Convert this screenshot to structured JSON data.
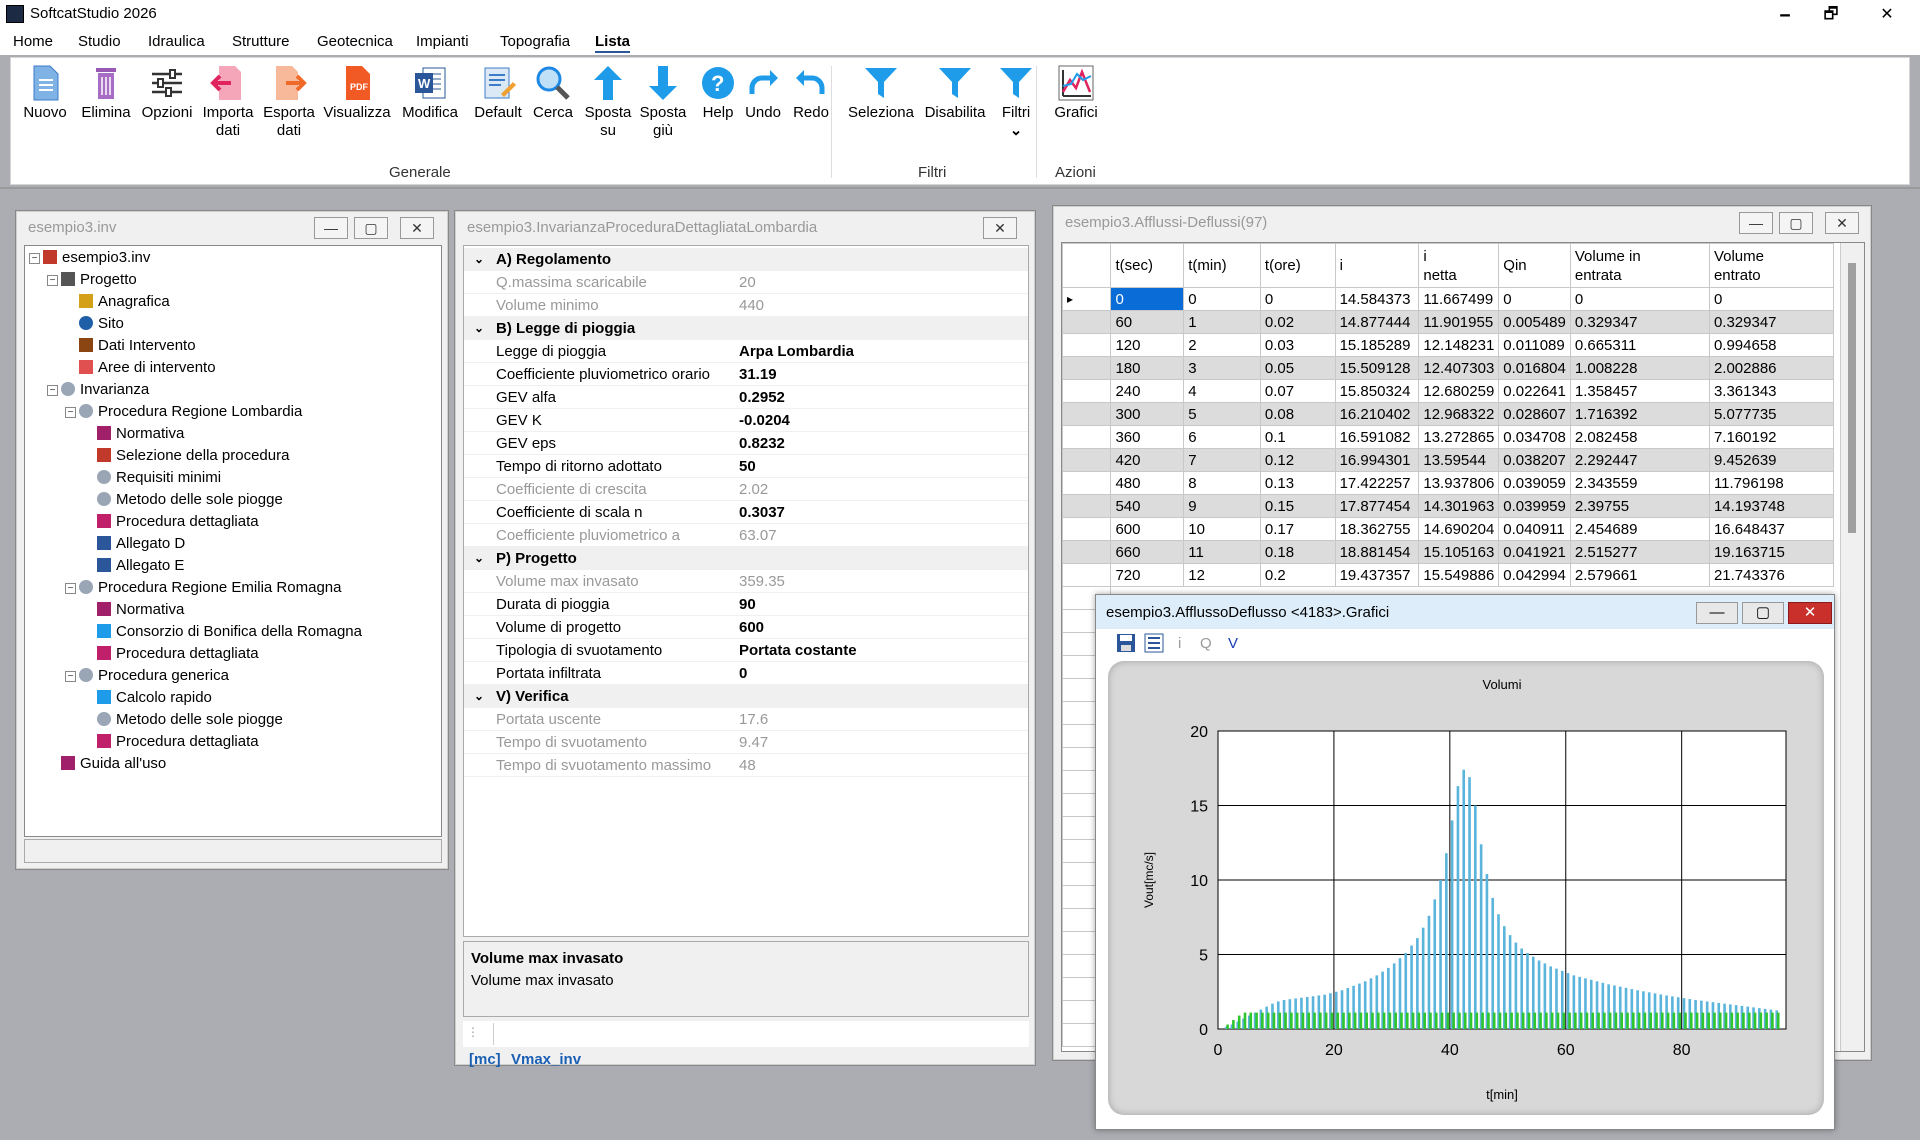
{
  "app": {
    "title": "SoftcatStudio 2026",
    "min": "🗕",
    "max": "🗗",
    "close": "✕"
  },
  "menu": [
    "Home",
    "Studio",
    "Idraulica",
    "Strutture",
    "Geotecnica",
    "Impianti",
    "Topografia",
    "Lista"
  ],
  "ribbon": {
    "buttons": [
      {
        "label": "Nuovo",
        "icon": "new-doc-icon"
      },
      {
        "label": "Elimina",
        "icon": "trash-icon"
      },
      {
        "label": "Opzioni",
        "icon": "sliders-icon"
      },
      {
        "label": "Importa dati",
        "icon": "import-icon"
      },
      {
        "label": "Esporta dati",
        "icon": "export-icon"
      },
      {
        "label": "Visualizza",
        "icon": "pdf-icon"
      },
      {
        "label": "Modifica",
        "icon": "word-icon"
      },
      {
        "label": "Default",
        "icon": "default-icon"
      },
      {
        "label": "Cerca",
        "icon": "search-icon"
      },
      {
        "label": "Sposta su",
        "icon": "arrow-up-icon"
      },
      {
        "label": "Sposta giù",
        "icon": "arrow-down-icon"
      },
      {
        "label": "Help",
        "icon": "help-icon"
      },
      {
        "label": "Undo",
        "icon": "undo-icon"
      },
      {
        "label": "Redo",
        "icon": "redo-icon"
      },
      {
        "label": "Seleziona",
        "icon": "filter-icon"
      },
      {
        "label": "Disabilita",
        "icon": "filter-icon"
      },
      {
        "label": "Filtri",
        "icon": "filter-icon"
      },
      {
        "label": "Grafici",
        "icon": "chart-icon"
      }
    ],
    "groups": {
      "generale": "Generale",
      "filtri": "Filtri",
      "azioni": "Azioni"
    },
    "filtri_chevron": "⌄"
  },
  "tree_window": {
    "title": "esempio3.inv"
  },
  "tree": [
    {
      "label": "esempio3.inv",
      "level": 0,
      "exp": "−"
    },
    {
      "label": "Progetto",
      "level": 1,
      "exp": "−"
    },
    {
      "label": "Anagrafica",
      "level": 2
    },
    {
      "label": "Sito",
      "level": 2
    },
    {
      "label": "Dati Intervento",
      "level": 2
    },
    {
      "label": "Aree di intervento",
      "level": 2
    },
    {
      "label": "Invarianza",
      "level": 1,
      "exp": "−"
    },
    {
      "label": "Procedura Regione Lombardia",
      "level": 2,
      "exp": "−"
    },
    {
      "label": "Normativa",
      "level": 3
    },
    {
      "label": "Selezione della procedura",
      "level": 3
    },
    {
      "label": "Requisiti minimi",
      "level": 3
    },
    {
      "label": "Metodo delle sole piogge",
      "level": 3
    },
    {
      "label": "Procedura dettagliata",
      "level": 3
    },
    {
      "label": "Allegato D",
      "level": 3
    },
    {
      "label": "Allegato E",
      "level": 3
    },
    {
      "label": "Procedura Regione Emilia Romagna",
      "level": 2,
      "exp": "−"
    },
    {
      "label": "Normativa",
      "level": 3
    },
    {
      "label": "Consorzio di Bonifica della Romagna",
      "level": 3
    },
    {
      "label": "Procedura dettagliata",
      "level": 3
    },
    {
      "label": "Procedura generica",
      "level": 2,
      "exp": "−"
    },
    {
      "label": "Calcolo rapido",
      "level": 3
    },
    {
      "label": "Metodo delle sole piogge",
      "level": 3
    },
    {
      "label": "Procedura dettagliata",
      "level": 3
    },
    {
      "label": "Guida all'uso",
      "level": 1
    }
  ],
  "prop_window": {
    "title": "esempio3.InvarianzaProceduraDettagliataLombardia"
  },
  "props": [
    {
      "cat": true,
      "name": "A) Regolamento"
    },
    {
      "name": "Q.massima scaricabile",
      "value": "20",
      "ro": true
    },
    {
      "name": "Volume minimo",
      "value": "440",
      "ro": true
    },
    {
      "cat": true,
      "name": "B) Legge di pioggia"
    },
    {
      "name": "Legge di pioggia",
      "value": "Arpa Lombardia",
      "b": true
    },
    {
      "name": "Coefficiente pluviometrico orario",
      "value": "31.19",
      "b": true
    },
    {
      "name": "GEV alfa",
      "value": "0.2952",
      "b": true
    },
    {
      "name": "GEV K",
      "value": "-0.0204",
      "b": true
    },
    {
      "name": "GEV eps",
      "value": "0.8232",
      "b": true
    },
    {
      "name": "Tempo di ritorno adottato",
      "value": "50",
      "b": true
    },
    {
      "name": "Coefficiente di crescita",
      "value": "2.02",
      "ro": true
    },
    {
      "name": "Coefficiente di scala n",
      "value": "0.3037",
      "b": true
    },
    {
      "name": "Coefficiente pluviometrico a",
      "value": "63.07",
      "ro": true
    },
    {
      "cat": true,
      "name": "P) Progetto"
    },
    {
      "name": "Volume max invasato",
      "value": "359.35",
      "ro": true
    },
    {
      "name": "Durata di pioggia",
      "value": "90",
      "b": true
    },
    {
      "name": "Volume di progetto",
      "value": "600",
      "b": true
    },
    {
      "name": "Tipologia di svuotamento",
      "value": "Portata costante",
      "b": true
    },
    {
      "name": "Portata infiltrata",
      "value": "0",
      "b": true
    },
    {
      "cat": true,
      "name": "V) Verifica"
    },
    {
      "name": "Portata uscente",
      "value": "17.6",
      "ro": true
    },
    {
      "name": "Tempo di svuotamento",
      "value": "9.47",
      "ro": true
    },
    {
      "name": "Tempo di svuotamento massimo",
      "value": "48",
      "ro": true
    }
  ],
  "prop_desc": {
    "title": "Volume max invasato",
    "text": "Volume max invasato"
  },
  "prop_footer": {
    "unit": "[mc]",
    "var": "Vmax_inv"
  },
  "grid_window": {
    "title": "esempio3.Afflussi-Deflussi(97)"
  },
  "grid": {
    "headers": [
      [
        "t(sec)",
        ""
      ],
      [
        "t(min)",
        ""
      ],
      [
        "t(ore)",
        ""
      ],
      [
        "i",
        ""
      ],
      [
        "i",
        "netta"
      ],
      [
        "Qin",
        ""
      ],
      [
        "Volume in",
        "entrata"
      ],
      [
        "Volume",
        "entrato"
      ]
    ],
    "rows": [
      [
        "0",
        "0",
        "0",
        "14.584373",
        "11.667499",
        "0",
        "0",
        "0"
      ],
      [
        "60",
        "1",
        "0.02",
        "14.877444",
        "11.901955",
        "0.005489",
        "0.329347",
        "0.329347"
      ],
      [
        "120",
        "2",
        "0.03",
        "15.185289",
        "12.148231",
        "0.011089",
        "0.665311",
        "0.994658"
      ],
      [
        "180",
        "3",
        "0.05",
        "15.509128",
        "12.407303",
        "0.016804",
        "1.008228",
        "2.002886"
      ],
      [
        "240",
        "4",
        "0.07",
        "15.850324",
        "12.680259",
        "0.022641",
        "1.358457",
        "3.361343"
      ],
      [
        "300",
        "5",
        "0.08",
        "16.210402",
        "12.968322",
        "0.028607",
        "1.716392",
        "5.077735"
      ],
      [
        "360",
        "6",
        "0.1",
        "16.591082",
        "13.272865",
        "0.034708",
        "2.082458",
        "7.160192"
      ],
      [
        "420",
        "7",
        "0.12",
        "16.994301",
        "13.59544",
        "0.038207",
        "2.292447",
        "9.452639"
      ],
      [
        "480",
        "8",
        "0.13",
        "17.422257",
        "13.937806",
        "0.039059",
        "2.343559",
        "11.796198"
      ],
      [
        "540",
        "9",
        "0.15",
        "17.877454",
        "14.301963",
        "0.039959",
        "2.39755",
        "14.193748"
      ],
      [
        "600",
        "10",
        "0.17",
        "18.362755",
        "14.690204",
        "0.040911",
        "2.454689",
        "16.648437"
      ],
      [
        "660",
        "11",
        "0.18",
        "18.881454",
        "15.105163",
        "0.041921",
        "2.515277",
        "19.163715"
      ],
      [
        "720",
        "12",
        "0.2",
        "19.437357",
        "15.549886",
        "0.042994",
        "2.579661",
        "21.743376"
      ]
    ]
  },
  "chart_window": {
    "title": "esempio3.AfflussoDeflusso <4183>.Grafici",
    "tb_i": "i",
    "tb_q": "Q",
    "tb_v": "V"
  },
  "chart_data": {
    "type": "bar",
    "title": "Volumi",
    "xlabel": "t[min]",
    "ylabel": "Vout[mc/s]",
    "xlim": [
      0,
      98
    ],
    "ylim": [
      0,
      20
    ],
    "xticks": [
      0,
      20,
      40,
      60,
      80
    ],
    "yticks": [
      0,
      5,
      10,
      15,
      20
    ],
    "grid": true,
    "series": [
      {
        "color": "#5ab4dc",
        "values": [
          0,
          0.15,
          0.3,
          0.5,
          0.7,
          0.9,
          1.1,
          1.3,
          1.5,
          1.7,
          1.85,
          1.95,
          2.0,
          2.05,
          2.1,
          2.15,
          2.2,
          2.25,
          2.3,
          2.4,
          2.5,
          2.6,
          2.75,
          2.9,
          3.05,
          3.2,
          3.4,
          3.6,
          3.85,
          4.1,
          4.4,
          4.75,
          5.1,
          5.6,
          6.1,
          6.8,
          7.6,
          8.7,
          10.0,
          11.8,
          14.0,
          16.3,
          17.4,
          16.9,
          15.0,
          12.4,
          10.4,
          8.8,
          7.7,
          6.9,
          6.3,
          5.8,
          5.4,
          5.1,
          4.85,
          4.6,
          4.4,
          4.2,
          4.05,
          3.9,
          3.75,
          3.6,
          3.5,
          3.4,
          3.3,
          3.2,
          3.1,
          3.0,
          2.92,
          2.84,
          2.76,
          2.68,
          2.6,
          2.53,
          2.46,
          2.39,
          2.32,
          2.25,
          2.19,
          2.13,
          2.07,
          2.01,
          1.95,
          1.9,
          1.85,
          1.8,
          1.75,
          1.7,
          1.65,
          1.6,
          1.55,
          1.5,
          1.45,
          1.4,
          1.35,
          1.3,
          1.25
        ]
      },
      {
        "color": "#2ec52e",
        "values": [
          0,
          0.3,
          0.6,
          0.9,
          1.1,
          1.1,
          1.1,
          1.1,
          1.1,
          1.1,
          1.1,
          1.1,
          1.1,
          1.1,
          1.1,
          1.1,
          1.1,
          1.1,
          1.1,
          1.1,
          1.1,
          1.1,
          1.1,
          1.1,
          1.1,
          1.1,
          1.1,
          1.1,
          1.1,
          1.1,
          1.1,
          1.1,
          1.1,
          1.1,
          1.1,
          1.1,
          1.1,
          1.1,
          1.1,
          1.1,
          1.1,
          1.1,
          1.1,
          1.1,
          1.1,
          1.1,
          1.1,
          1.1,
          1.1,
          1.1,
          1.1,
          1.1,
          1.1,
          1.1,
          1.1,
          1.1,
          1.1,
          1.1,
          1.1,
          1.1,
          1.1,
          1.1,
          1.1,
          1.1,
          1.1,
          1.1,
          1.1,
          1.1,
          1.1,
          1.1,
          1.1,
          1.1,
          1.1,
          1.1,
          1.1,
          1.1,
          1.1,
          1.1,
          1.1,
          1.1,
          1.1,
          1.1,
          1.1,
          1.1,
          1.1,
          1.1,
          1.1,
          1.1,
          1.1,
          1.1,
          1.1,
          1.1,
          1.1,
          1.1,
          1.1,
          1.1,
          1.1
        ]
      }
    ]
  }
}
